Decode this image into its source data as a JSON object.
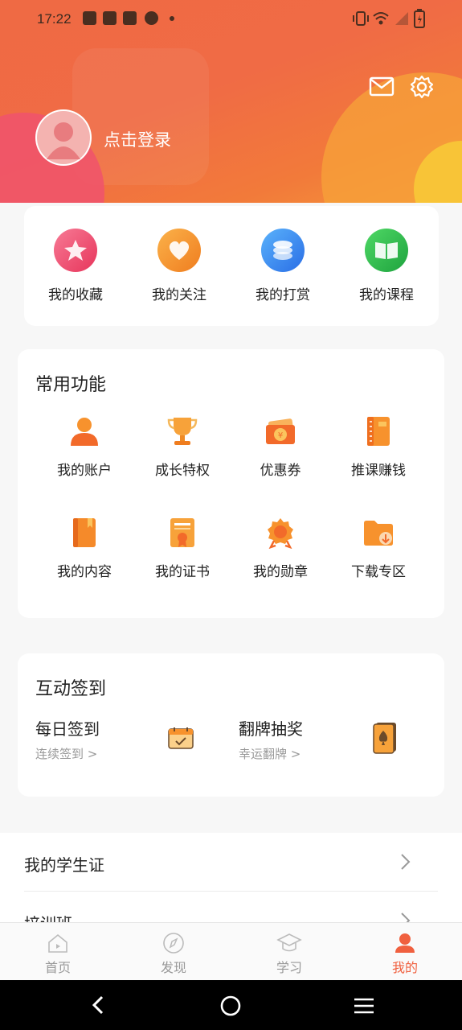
{
  "status": {
    "time": "17:22"
  },
  "header": {
    "login_text": "点击登录"
  },
  "quick": [
    {
      "label": "我的收藏",
      "icon": "star-icon",
      "color": "#f0547a"
    },
    {
      "label": "我的关注",
      "icon": "heart-icon",
      "color": "#f59b2e"
    },
    {
      "label": "我的打赏",
      "icon": "coins-icon",
      "color": "#3a8df0"
    },
    {
      "label": "我的课程",
      "icon": "book-icon",
      "color": "#2fbf4f"
    }
  ],
  "common": {
    "title": "常用功能",
    "items": [
      {
        "label": "我的账户",
        "icon": "user-icon"
      },
      {
        "label": "成长特权",
        "icon": "trophy-icon"
      },
      {
        "label": "优惠券",
        "icon": "coupon-icon"
      },
      {
        "label": "推课赚钱",
        "icon": "notebook-icon"
      },
      {
        "label": "我的内容",
        "icon": "book-icon"
      },
      {
        "label": "我的证书",
        "icon": "certificate-icon"
      },
      {
        "label": "我的勋章",
        "icon": "medal-icon"
      },
      {
        "label": "下载专区",
        "icon": "download-folder-icon"
      }
    ]
  },
  "checkin": {
    "title": "互动签到",
    "daily": {
      "title": "每日签到",
      "sub": "连续签到 >"
    },
    "flip": {
      "title": "翻牌抽奖",
      "sub": "幸运翻牌 >"
    }
  },
  "list": [
    {
      "label": "我的学生证"
    },
    {
      "label": "培训班"
    }
  ],
  "tabs": [
    {
      "label": "首页",
      "icon": "home-icon",
      "active": false
    },
    {
      "label": "发现",
      "icon": "compass-icon",
      "active": false
    },
    {
      "label": "学习",
      "icon": "graduation-cap-icon",
      "active": false
    },
    {
      "label": "我的",
      "icon": "user-icon",
      "active": true
    }
  ],
  "colors": {
    "accent": "#f0603f",
    "tab_inactive": "#999999"
  }
}
